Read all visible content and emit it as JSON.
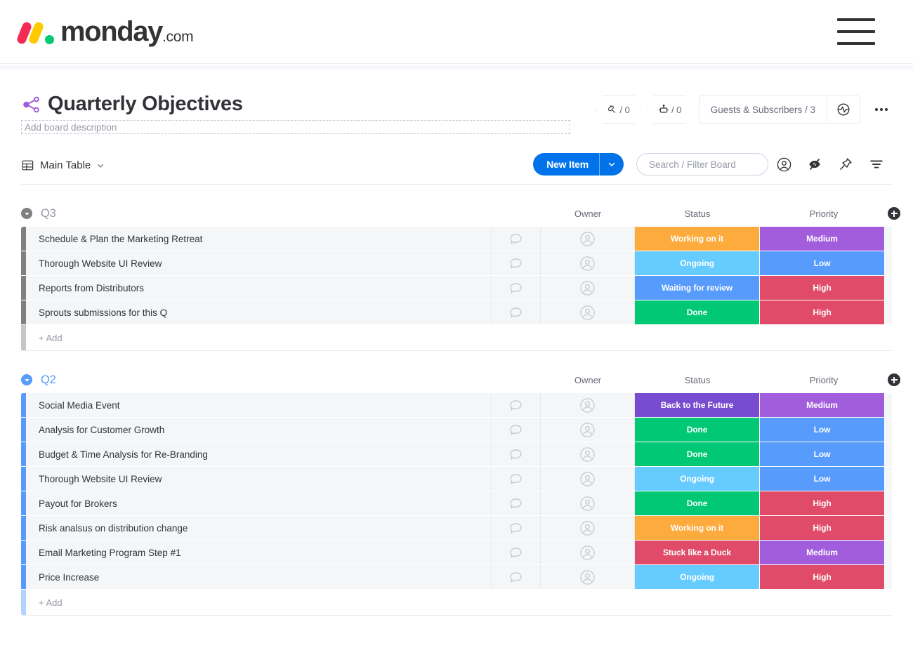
{
  "app": {
    "logo_text": "monday",
    "logo_suffix": ".com",
    "menu_icon": "hamburger-menu-icon"
  },
  "board": {
    "title": "Quarterly Objectives",
    "description_placeholder": "Add board description",
    "share_icon": "share-nodes-icon",
    "badges": [
      {
        "icon": "integrations-plug-icon",
        "label": "/ 0"
      },
      {
        "icon": "automations-robot-icon",
        "label": "/ 0"
      }
    ],
    "guests_label": "Guests & Subscribers / 3",
    "activity_icon": "activity-log-icon",
    "more_menu_icon": "more-options-icon"
  },
  "toolbar": {
    "view_icon": "table-view-icon",
    "view_label": "Main Table",
    "view_chevron_icon": "chevron-down-icon",
    "new_item_label": "New Item",
    "new_item_chevron_icon": "chevron-down-icon",
    "search_placeholder": "Search / Filter Board",
    "search_value": "",
    "icons": [
      "person-filter-icon",
      "hide-eye-off-icon",
      "pin-icon",
      "filter-icon"
    ]
  },
  "columns": {
    "owner": "Owner",
    "status": "Status",
    "priority": "Priority",
    "add_column_icon": "add-column-icon"
  },
  "colors": {
    "orange": "#fdab3d",
    "light_blue": "#66ccff",
    "blue": "#579bfc",
    "green": "#00c875",
    "purple": "#a25ddc",
    "dark_purple": "#784bd1",
    "red": "#df4b68",
    "group_gray": "#808080",
    "group_blue": "#579bfc",
    "brand_blue": "#0073ea"
  },
  "groups": [
    {
      "name": "Q3",
      "color": "#9699a6",
      "bar_color": "#808080",
      "collapse_icon": "collapse-arrow-icon",
      "add_label": "+ Add",
      "items": [
        {
          "name": "Schedule & Plan the Marketing Retreat",
          "chat_icon": "chat-bubble-icon",
          "owner_icon": "person-avatar-icon",
          "status": "Working on it",
          "status_color": "#fdab3d",
          "priority": "Medium",
          "priority_color": "#a25ddc"
        },
        {
          "name": "Thorough Website UI Review",
          "chat_icon": "chat-bubble-icon",
          "owner_icon": "person-avatar-icon",
          "status": "Ongoing",
          "status_color": "#66ccff",
          "priority": "Low",
          "priority_color": "#579bfc"
        },
        {
          "name": "Reports from Distributors",
          "chat_icon": "chat-bubble-icon",
          "owner_icon": "person-avatar-icon",
          "status": "Waiting for review",
          "status_color": "#579bfc",
          "priority": "High",
          "priority_color": "#df4b68"
        },
        {
          "name": "Sprouts submissions for this Q",
          "chat_icon": "chat-bubble-icon",
          "owner_icon": "person-avatar-icon",
          "status": "Done",
          "status_color": "#00c875",
          "priority": "High",
          "priority_color": "#df4b68"
        }
      ]
    },
    {
      "name": "Q2",
      "color": "#579bfc",
      "bar_color": "#579bfc",
      "collapse_icon": "collapse-arrow-icon",
      "add_label": "+ Add",
      "items": [
        {
          "name": "Social Media Event",
          "chat_icon": "chat-bubble-icon",
          "owner_icon": "person-avatar-icon",
          "status": "Back to the Future",
          "status_color": "#784bd1",
          "priority": "Medium",
          "priority_color": "#a25ddc"
        },
        {
          "name": "Analysis for Customer Growth",
          "chat_icon": "chat-bubble-icon",
          "owner_icon": "person-avatar-icon",
          "status": "Done",
          "status_color": "#00c875",
          "priority": "Low",
          "priority_color": "#579bfc"
        },
        {
          "name": "Budget & Time Analysis for Re-Branding",
          "chat_icon": "chat-bubble-icon",
          "owner_icon": "person-avatar-icon",
          "status": "Done",
          "status_color": "#00c875",
          "priority": "Low",
          "priority_color": "#579bfc"
        },
        {
          "name": "Thorough Website UI Review",
          "chat_icon": "chat-bubble-icon",
          "owner_icon": "person-avatar-icon",
          "status": "Ongoing",
          "status_color": "#66ccff",
          "priority": "Low",
          "priority_color": "#579bfc"
        },
        {
          "name": "Payout for Brokers",
          "chat_icon": "chat-bubble-icon",
          "owner_icon": "person-avatar-icon",
          "status": "Done",
          "status_color": "#00c875",
          "priority": "High",
          "priority_color": "#df4b68"
        },
        {
          "name": "Risk analsus on distribution change",
          "chat_icon": "chat-bubble-icon",
          "owner_icon": "person-avatar-icon",
          "status": "Working on it",
          "status_color": "#fdab3d",
          "priority": "High",
          "priority_color": "#df4b68"
        },
        {
          "name": "Email Marketing Program Step #1",
          "chat_icon": "chat-bubble-icon",
          "owner_icon": "person-avatar-icon",
          "status": "Stuck like a Duck",
          "status_color": "#df4b68",
          "priority": "Medium",
          "priority_color": "#a25ddc"
        },
        {
          "name": "Price Increase",
          "chat_icon": "chat-bubble-icon",
          "owner_icon": "person-avatar-icon",
          "status": "Ongoing",
          "status_color": "#66ccff",
          "priority": "High",
          "priority_color": "#df4b68"
        }
      ]
    }
  ]
}
